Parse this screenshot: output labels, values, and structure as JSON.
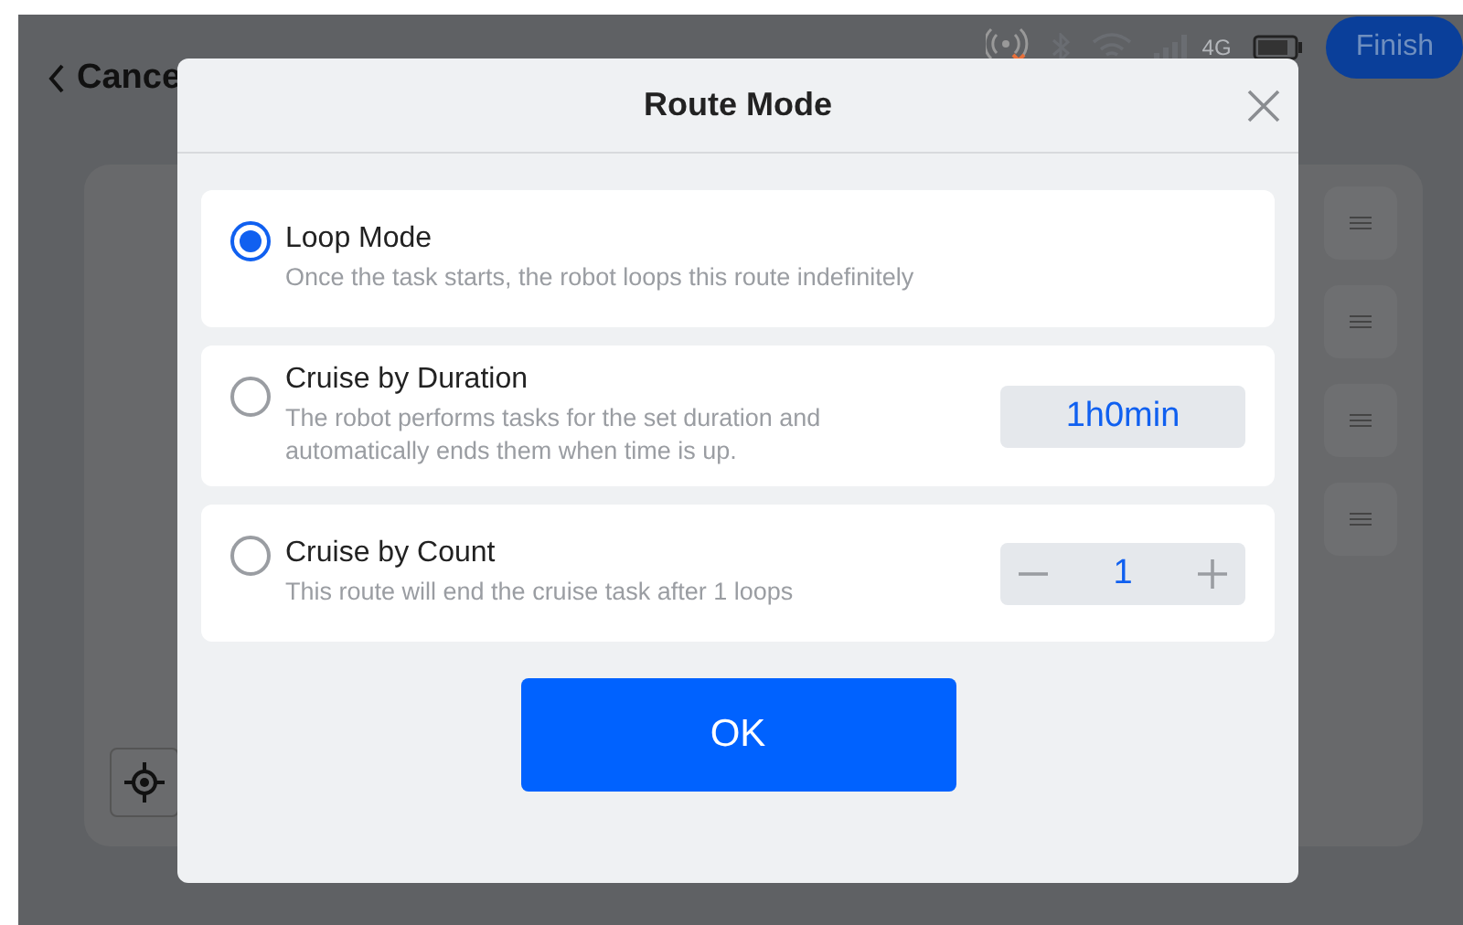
{
  "top_bar": {
    "back_label": "Cance",
    "network_label": "4G",
    "finish_button": "Finish"
  },
  "modal": {
    "title": "Route Mode",
    "options": [
      {
        "kind": "plain",
        "title": "Loop Mode",
        "description": "Once the task starts, the robot loops this route indefinitely",
        "selected": true
      },
      {
        "kind": "duration",
        "title": "Cruise by Duration",
        "description": "The robot performs tasks for the set duration and automatically ends them when time is up.",
        "value": "1h0min",
        "selected": false
      },
      {
        "kind": "count",
        "title": "Cruise by Count",
        "description": "This route will end the cruise task after 1 loops",
        "value": "1",
        "selected": false
      }
    ],
    "ok_button": "OK"
  }
}
